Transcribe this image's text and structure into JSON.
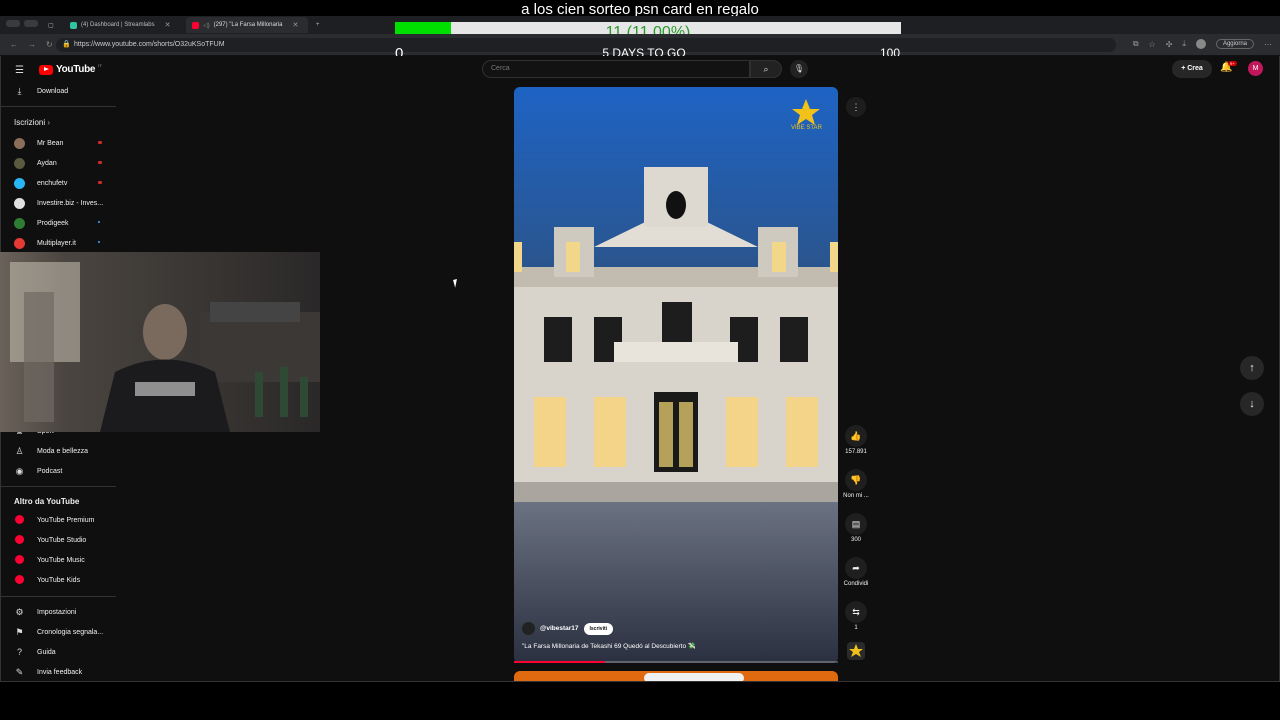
{
  "overlay": {
    "title": "a los cien sorteo psn card en regalo",
    "goal_text": "11 (11.00%)",
    "goal_fraction": 0.11,
    "goal_min": "0",
    "goal_max": "100",
    "days_left": "5 DAYS TO GO"
  },
  "browser": {
    "tabs": [
      {
        "label": "(4) Dashboard | Streamlabs"
      },
      {
        "label": "(297) \"La Farsa Millonaria"
      }
    ],
    "url": "https://www.youtube.com/shorts/O32uKSoTFUM",
    "update_label": "Aggiorna"
  },
  "youtube": {
    "search_placeholder": "Cerca",
    "create_label": "Crea",
    "notifications_badge": "9+",
    "avatar_letter": "M",
    "logo_word": "YouTube",
    "logo_country": "IT"
  },
  "sidebar": {
    "download_label": "Download",
    "subscriptions_heading": "Iscrizioni",
    "subscriptions": [
      {
        "label": "Mr Bean",
        "color": "#8a6e5a"
      },
      {
        "label": "Aydan",
        "color": "#5a5a40"
      },
      {
        "label": "enchufetv",
        "color": "#29b6f6"
      },
      {
        "label": "Investire.biz - Inves...",
        "color": "#e0e0e0"
      },
      {
        "label": "Prodigeek",
        "color": "#2e7d32"
      },
      {
        "label": "Multiplayer.it",
        "color": "#e53935"
      }
    ],
    "explore_partial": "Sport",
    "explore": [
      {
        "label": "Moda e bellezza"
      },
      {
        "label": "Podcast"
      }
    ],
    "more_heading": "Altro da YouTube",
    "more": [
      {
        "label": "YouTube Premium"
      },
      {
        "label": "YouTube Studio"
      },
      {
        "label": "YouTube Music"
      },
      {
        "label": "YouTube Kids"
      }
    ],
    "settings": [
      {
        "label": "Impostazioni"
      },
      {
        "label": "Cronologia segnala..."
      },
      {
        "label": "Guida"
      },
      {
        "label": "Invia feedback"
      }
    ]
  },
  "short": {
    "channel_handle": "@vibestar17",
    "subscribe_label": "Iscriviti",
    "title": "\"La Farsa Millonaria de Tekashi 69 Quedó al Descubierto 💸",
    "watermark": "VIBE STAR",
    "played_fraction": 0.28,
    "likes": "157.891",
    "dislike_label": "Non mi ...",
    "comments": "300",
    "share_label": "Condividi",
    "remix_count": "1"
  }
}
